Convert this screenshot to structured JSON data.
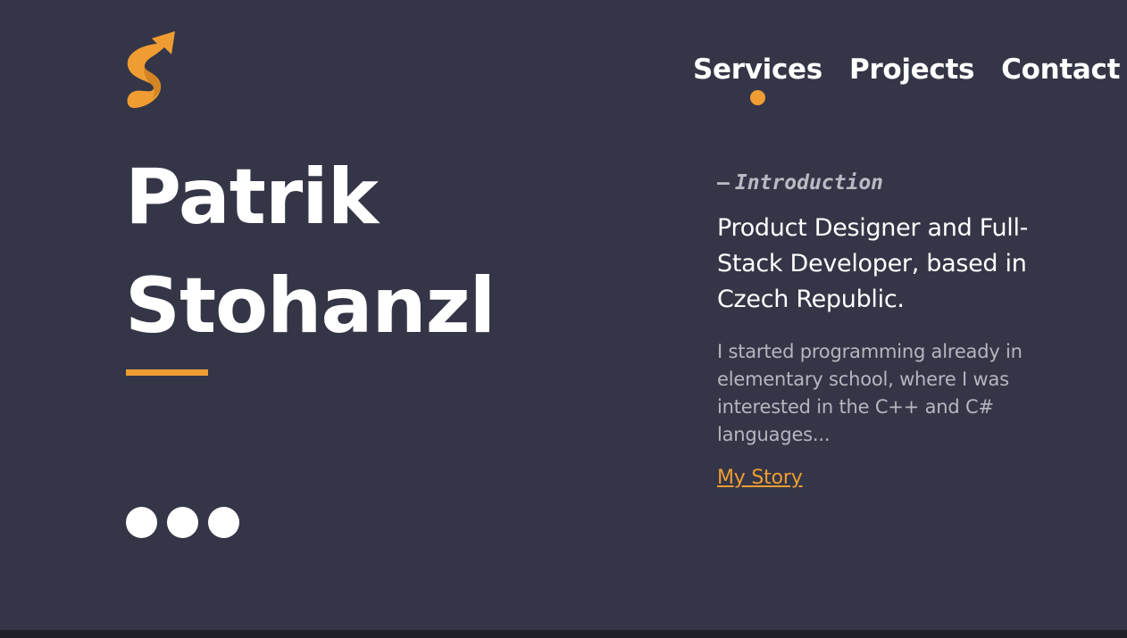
{
  "colors": {
    "background": "#343647",
    "accent": "#ef9d32",
    "text": "#ffffff",
    "muted": "#b5b6bf"
  },
  "logo": {
    "icon": "s-arrow-logo-icon"
  },
  "nav": {
    "items": [
      {
        "label": "Services",
        "active": true
      },
      {
        "label": "Projects",
        "active": false
      },
      {
        "label": "Contact",
        "active": false
      }
    ]
  },
  "hero": {
    "first_name": "Patrik",
    "last_name": "Stohanzl",
    "social_dots": 3
  },
  "intro": {
    "eyebrow_dash": "–",
    "eyebrow": "Introduction",
    "headline": "Product Designer and Full-Stack Developer, based in Czech Republic.",
    "paragraph": "I started programming already in elementary school, where I was interested in the C++ and C# languages...",
    "cta": "My Story "
  }
}
